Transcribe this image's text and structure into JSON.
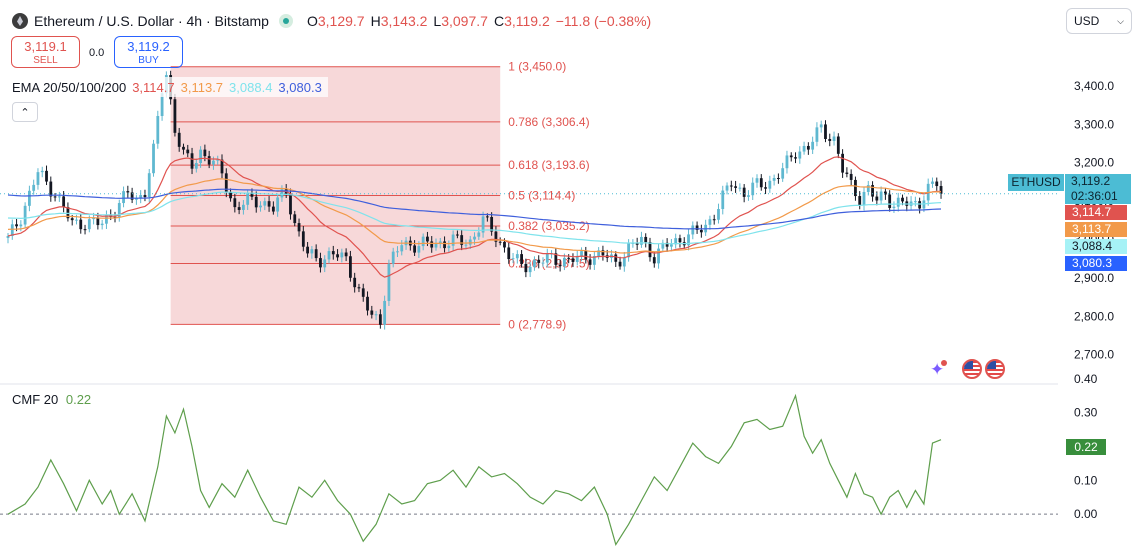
{
  "header": {
    "symbol_title": "Ethereum / U.S. Dollar · 4h · Bitstamp",
    "open_label": "O",
    "open": "3,129.7",
    "high_label": "H",
    "high": "3,143.2",
    "low_label": "L",
    "low": "3,097.7",
    "close_label": "C",
    "close": "3,119.2",
    "change": "−11.8 (−0.38%)"
  },
  "trade": {
    "sell_price": "3,119.1",
    "sell_label": "SELL",
    "spread": "0.0",
    "buy_price": "3,119.2",
    "buy_label": "BUY"
  },
  "ema_legend": {
    "label": "EMA 20/50/100/200",
    "values": [
      "3,114.7",
      "3,113.7",
      "3,088.4",
      "3,080.3"
    ]
  },
  "cmf_legend": {
    "label": "CMF 20",
    "value": "0.22"
  },
  "currency": "USD",
  "price_scale": {
    "symbol": "ETHUSD",
    "current_price": "3,119.2",
    "countdown": "02:36:01",
    "ema_tags": [
      "3,114.7",
      "3,113.7",
      "3,088.4",
      "3,080.3"
    ],
    "cmf_tag": "0.22"
  },
  "icons": {
    "collapse": "chevron-up-icon",
    "dropdown": "chevron-down-icon",
    "logo": "ethereum-logo-icon",
    "status": "market-open-dot-icon",
    "events": [
      "sparkle-idea-icon",
      "us-flag-icon",
      "us-flag-icon"
    ]
  },
  "colors": {
    "up": "#5fb8d0",
    "down": "#131722",
    "fib_zone": "#f4c7c9",
    "fib_line": "#e0534f",
    "ema20": "#e0534f",
    "ema50": "#f29a4a",
    "ema100": "#7fe3ec",
    "ema200": "#3f5fdc",
    "cmf": "#5e9e4c",
    "current": "#4cbcd4"
  },
  "chart_data": [
    {
      "type": "candlestick",
      "title": "Ethereum / U.S. Dollar · 4h · Bitstamp",
      "ylim": [
        2660,
        3530
      ],
      "y_ticks": [
        2700,
        2800,
        2900,
        3000,
        3100,
        3200,
        3300,
        3400
      ],
      "y_tick_labels": [
        "2,700.0",
        "2,800.0",
        "2,900.0",
        "3,000.0",
        "3,100.0",
        "3,200.0",
        "3,300.0",
        "3,400.0"
      ],
      "grid": false,
      "last_price": 3119.2,
      "anchors": [
        [
          0,
          3000
        ],
        [
          3,
          3060
        ],
        [
          7,
          3175
        ],
        [
          11,
          3120
        ],
        [
          15,
          3040
        ],
        [
          18,
          3045
        ],
        [
          22,
          3040
        ],
        [
          25,
          3080
        ],
        [
          28,
          3120
        ],
        [
          30,
          3100
        ],
        [
          32,
          3130
        ],
        [
          34,
          3230
        ],
        [
          36,
          3390
        ],
        [
          37,
          3430
        ],
        [
          39,
          3290
        ],
        [
          41,
          3220
        ],
        [
          43,
          3190
        ],
        [
          45,
          3230
        ],
        [
          48,
          3200
        ],
        [
          50,
          3170
        ],
        [
          53,
          3080
        ],
        [
          56,
          3100
        ],
        [
          59,
          3100
        ],
        [
          62,
          3080
        ],
        [
          65,
          3130
        ],
        [
          67,
          3040
        ],
        [
          70,
          2960
        ],
        [
          73,
          2950
        ],
        [
          76,
          2960
        ],
        [
          79,
          2950
        ],
        [
          82,
          2860
        ],
        [
          85,
          2800
        ],
        [
          87,
          2790
        ],
        [
          89,
          2930
        ],
        [
          92,
          2990
        ],
        [
          96,
          2985
        ],
        [
          100,
          2990
        ],
        [
          104,
          2995
        ],
        [
          108,
          2995
        ],
        [
          111,
          3050
        ],
        [
          114,
          3010
        ],
        [
          117,
          2960
        ],
        [
          120,
          2930
        ],
        [
          123,
          2940
        ],
        [
          127,
          2950
        ],
        [
          131,
          2945
        ],
        [
          135,
          2955
        ],
        [
          139,
          2960
        ],
        [
          142,
          2940
        ],
        [
          145,
          2975
        ],
        [
          148,
          3000
        ],
        [
          151,
          2955
        ],
        [
          154,
          2985
        ],
        [
          157,
          3000
        ],
        [
          160,
          3015
        ],
        [
          163,
          3035
        ],
        [
          166,
          3085
        ],
        [
          169,
          3150
        ],
        [
          172,
          3120
        ],
        [
          175,
          3140
        ],
        [
          178,
          3150
        ],
        [
          181,
          3180
        ],
        [
          184,
          3230
        ],
        [
          187,
          3240
        ],
        [
          190,
          3290
        ],
        [
          193,
          3260
        ],
        [
          195,
          3180
        ],
        [
          197,
          3140
        ],
        [
          199,
          3110
        ],
        [
          201,
          3130
        ],
        [
          203,
          3100
        ],
        [
          205,
          3120
        ],
        [
          207,
          3090
        ],
        [
          209,
          3095
        ],
        [
          211,
          3090
        ],
        [
          213,
          3100
        ],
        [
          215,
          3130
        ],
        [
          217,
          3145
        ],
        [
          218,
          3119
        ]
      ],
      "series": [
        {
          "name": "EMA 20/50/100/200",
          "period": 20,
          "color": "#e0534f",
          "last": 3114.7
        },
        {
          "name": "EMA 20/50/100/200",
          "period": 50,
          "color": "#f29a4a",
          "last": 3113.7
        },
        {
          "name": "EMA 20/50/100/200",
          "period": 100,
          "color": "#7fe3ec",
          "last": 3088.4
        },
        {
          "name": "EMA 20/50/100/200",
          "period": 200,
          "color": "#3f5fdc",
          "last": 3080.3
        }
      ],
      "fibonacci": {
        "from_price": 3450.0,
        "to_price": 2778.9,
        "start_bar": 38,
        "end_bar": 115,
        "levels": [
          {
            "ratio": "1",
            "price": "3,450.0",
            "value": 3450.0
          },
          {
            "ratio": "0.786",
            "price": "3,306.4",
            "value": 3306.4
          },
          {
            "ratio": "0.618",
            "price": "3,193.6",
            "value": 3193.6
          },
          {
            "ratio": "0.5",
            "price": "3,114.4",
            "value": 3114.4
          },
          {
            "ratio": "0.382",
            "price": "3,035.2",
            "value": 3035.2
          },
          {
            "ratio": "0.236",
            "price": "2,937.5",
            "value": 2937.5
          },
          {
            "ratio": "0",
            "price": "2,778.9",
            "value": 2778.9
          }
        ]
      }
    },
    {
      "type": "line",
      "title": "CMF 20",
      "ylim": [
        -0.1,
        0.42
      ],
      "y_ticks": [
        0.0,
        0.1,
        0.2,
        0.3,
        0.4
      ],
      "y_tick_labels": [
        "0.00",
        "0.10",
        "0.20",
        "0.30",
        "0.40"
      ],
      "zero_line": "dashed",
      "points": [
        [
          0,
          0.0
        ],
        [
          4,
          0.03
        ],
        [
          7,
          0.08
        ],
        [
          10,
          0.16
        ],
        [
          13,
          0.09
        ],
        [
          16,
          0.01
        ],
        [
          19,
          0.1
        ],
        [
          22,
          0.03
        ],
        [
          24,
          0.07
        ],
        [
          26,
          0.0
        ],
        [
          29,
          0.06
        ],
        [
          32,
          -0.02
        ],
        [
          35,
          0.14
        ],
        [
          37,
          0.29
        ],
        [
          39,
          0.24
        ],
        [
          41,
          0.31
        ],
        [
          43,
          0.2
        ],
        [
          45,
          0.07
        ],
        [
          47,
          0.02
        ],
        [
          50,
          0.09
        ],
        [
          53,
          0.05
        ],
        [
          56,
          0.13
        ],
        [
          59,
          0.05
        ],
        [
          62,
          -0.02
        ],
        [
          65,
          -0.03
        ],
        [
          68,
          0.08
        ],
        [
          71,
          0.05
        ],
        [
          74,
          0.1
        ],
        [
          77,
          0.04
        ],
        [
          80,
          0.0
        ],
        [
          83,
          -0.08
        ],
        [
          86,
          -0.03
        ],
        [
          89,
          0.06
        ],
        [
          92,
          0.03
        ],
        [
          95,
          0.04
        ],
        [
          98,
          0.09
        ],
        [
          101,
          0.1
        ],
        [
          104,
          0.13
        ],
        [
          107,
          0.08
        ],
        [
          110,
          0.14
        ],
        [
          113,
          0.11
        ],
        [
          116,
          0.12
        ],
        [
          119,
          0.09
        ],
        [
          122,
          0.05
        ],
        [
          125,
          0.03
        ],
        [
          128,
          0.07
        ],
        [
          131,
          0.06
        ],
        [
          134,
          0.04
        ],
        [
          137,
          0.08
        ],
        [
          140,
          0.0
        ],
        [
          142,
          -0.09
        ],
        [
          145,
          -0.03
        ],
        [
          148,
          0.04
        ],
        [
          151,
          0.11
        ],
        [
          154,
          0.07
        ],
        [
          157,
          0.14
        ],
        [
          160,
          0.21
        ],
        [
          163,
          0.17
        ],
        [
          166,
          0.15
        ],
        [
          169,
          0.2
        ],
        [
          172,
          0.27
        ],
        [
          175,
          0.28
        ],
        [
          178,
          0.25
        ],
        [
          181,
          0.26
        ],
        [
          184,
          0.35
        ],
        [
          186,
          0.23
        ],
        [
          188,
          0.18
        ],
        [
          190,
          0.22
        ],
        [
          192,
          0.15
        ],
        [
          194,
          0.1
        ],
        [
          196,
          0.05
        ],
        [
          198,
          0.12
        ],
        [
          200,
          0.06
        ],
        [
          202,
          0.05
        ],
        [
          204,
          0.0
        ],
        [
          206,
          0.05
        ],
        [
          208,
          0.07
        ],
        [
          210,
          0.02
        ],
        [
          212,
          0.07
        ],
        [
          214,
          0.03
        ],
        [
          216,
          0.21
        ],
        [
          218,
          0.22
        ]
      ]
    }
  ]
}
